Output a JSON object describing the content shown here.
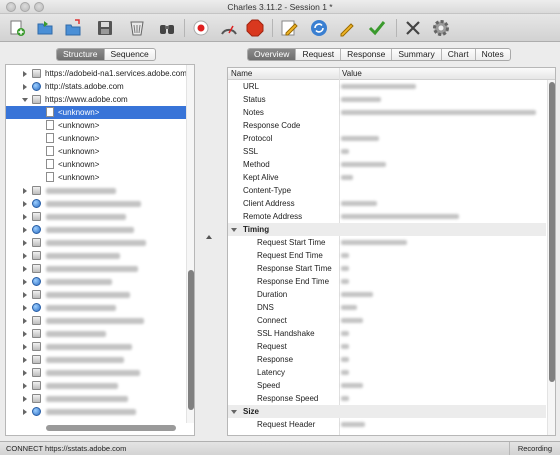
{
  "window": {
    "title": "Charles 3.11.2 - Session 1 *"
  },
  "toolbar": {
    "icons": [
      "new-session-icon",
      "open-icon",
      "import-icon",
      "save-icon",
      "clear-icon",
      "find-icon",
      "record-icon",
      "throttle-icon",
      "breakpoints-icon",
      "edit-icon",
      "repeat-icon",
      "compose-icon",
      "validate-icon",
      "tools-icon",
      "settings-icon"
    ]
  },
  "left": {
    "tabs": [
      "Structure",
      "Sequence"
    ],
    "active_tab": "Structure",
    "tree": [
      {
        "label": "https://adobeid-na1.services.adobe.com"
      },
      {
        "label": "http://stats.adobe.com"
      },
      {
        "label": "https://www.adobe.com"
      },
      {
        "label": "<unknown>"
      },
      {
        "label": "<unknown>"
      },
      {
        "label": "<unknown>"
      },
      {
        "label": "<unknown>"
      },
      {
        "label": "<unknown>"
      },
      {
        "label": "<unknown>"
      }
    ]
  },
  "right": {
    "tabs": [
      "Overview",
      "Request",
      "Response",
      "Summary",
      "Chart",
      "Notes"
    ],
    "active_tab": "Overview",
    "columns": {
      "name": "Name",
      "value": "Value"
    },
    "rows": [
      {
        "name": "URL"
      },
      {
        "name": "Status"
      },
      {
        "name": "Notes"
      },
      {
        "name": "Response Code"
      },
      {
        "name": "Protocol"
      },
      {
        "name": "SSL"
      },
      {
        "name": "Method"
      },
      {
        "name": "Kept Alive"
      },
      {
        "name": "Content-Type"
      },
      {
        "name": "Client Address"
      },
      {
        "name": "Remote Address"
      },
      {
        "name": "Timing"
      },
      {
        "name": "Request Start Time"
      },
      {
        "name": "Request End Time"
      },
      {
        "name": "Response Start Time"
      },
      {
        "name": "Response End Time"
      },
      {
        "name": "Duration"
      },
      {
        "name": "DNS"
      },
      {
        "name": "Connect"
      },
      {
        "name": "SSL Handshake"
      },
      {
        "name": "Request"
      },
      {
        "name": "Response"
      },
      {
        "name": "Latency"
      },
      {
        "name": "Speed"
      },
      {
        "name": "Response Speed"
      },
      {
        "name": "Size"
      },
      {
        "name": "Request Header"
      }
    ]
  },
  "status": {
    "left": "CONNECT https://sstats.adobe.com",
    "right": "Recording"
  }
}
